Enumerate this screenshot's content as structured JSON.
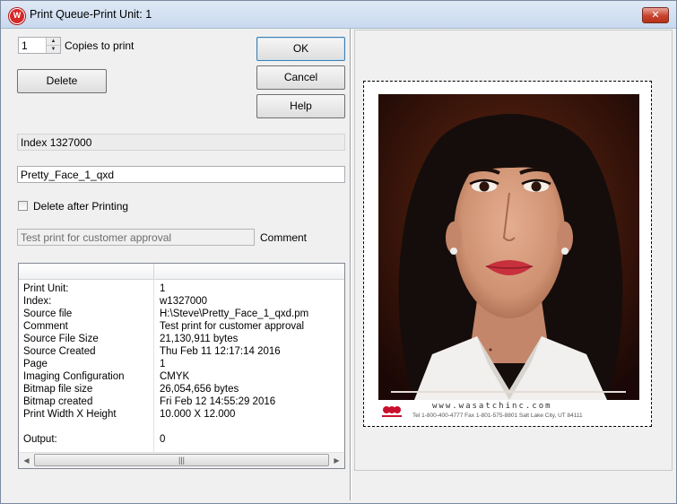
{
  "window": {
    "title": "Print Queue-Print Unit: 1"
  },
  "copies": {
    "value": "1",
    "label": "Copies to print"
  },
  "buttons": {
    "ok": "OK",
    "cancel": "Cancel",
    "help": "Help",
    "delete": "Delete"
  },
  "index_display": "Index 1327000",
  "job_name": "Pretty_Face_1_qxd",
  "delete_after": {
    "label": "Delete after Printing",
    "checked": false
  },
  "comment": {
    "value": "Test print for customer approval",
    "label": "Comment"
  },
  "details": {
    "rows": [
      {
        "key": "Print Unit:",
        "value": "1"
      },
      {
        "key": "Index:",
        "value": "w1327000"
      },
      {
        "key": "Source file",
        "value": "H:\\Steve\\Pretty_Face_1_qxd.pm"
      },
      {
        "key": "Comment",
        "value": "Test print for customer approval"
      },
      {
        "key": "Source File Size",
        "value": "21,130,911 bytes"
      },
      {
        "key": "Source Created",
        "value": "Thu Feb 11 12:17:14 2016"
      },
      {
        "key": "Page",
        "value": "1"
      },
      {
        "key": "Imaging Configuration",
        "value": "CMYK"
      },
      {
        "key": "Bitmap file size",
        "value": "26,054,656 bytes"
      },
      {
        "key": "Bitmap created",
        "value": "Fri Feb 12 14:55:29 2016"
      },
      {
        "key": "Print Width X Height",
        "value": "10.000 X 12.000"
      },
      {
        "key": "",
        "value": ""
      },
      {
        "key": "Output:",
        "value": "0"
      }
    ]
  },
  "preview": {
    "url_text": "www.wasatchinc.com",
    "info_text": "Tel 1-800-400-4777  Fax 1-801-575-8801  Salt Lake City, UT 84111",
    "colors": {
      "lip": "#c8303c",
      "hair": "#150d0b",
      "skin": "#d9a083",
      "shirt": "#f2f0ee"
    }
  }
}
